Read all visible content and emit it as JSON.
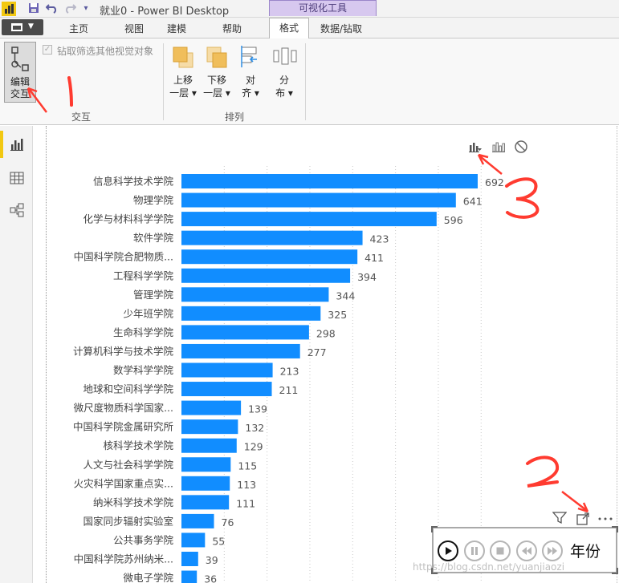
{
  "window": {
    "title": "就业0 - Power BI Desktop",
    "context_tab": "可视化工具"
  },
  "tabs": [
    {
      "label": "主页"
    },
    {
      "label": "视图"
    },
    {
      "label": "建模"
    },
    {
      "label": "帮助"
    },
    {
      "label": "格式",
      "active": true
    },
    {
      "label": "数据/钻取"
    }
  ],
  "ribbon": {
    "interaction_group": {
      "edit_interactions_label": "编辑\n交互",
      "drill_checkbox_label": "钻取筛选其他视觉对象",
      "group_label": "交互"
    },
    "arrange_group": {
      "bring_forward_label": "上移\n一层 ▾",
      "send_backward_label": "下移\n一层 ▾",
      "align_label": "对\n齐 ▾",
      "distribute_label": "分\n布 ▾",
      "group_label": "排列"
    }
  },
  "left_nav": {
    "items": [
      {
        "icon": "report-view-icon",
        "active": true
      },
      {
        "icon": "data-view-icon"
      },
      {
        "icon": "model-view-icon"
      }
    ]
  },
  "visual_header_icons": [
    "filter-icon",
    "focus-mode-icon",
    "more-options-icon"
  ],
  "interaction_icons": [
    "filter-interaction-icon",
    "highlight-interaction-icon",
    "none-interaction-icon"
  ],
  "chart_data": {
    "type": "bar",
    "orientation": "horizontal",
    "color": "#118dff",
    "categories": [
      "信息科学技术学院",
      "物理学院",
      "化学与材料科学学院",
      "软件学院",
      "中国科学院合肥物质...",
      "工程科学学院",
      "管理学院",
      "少年班学院",
      "生命科学学院",
      "计算机科学与技术学院",
      "数学科学学院",
      "地球和空间科学学院",
      "微尺度物质科学国家...",
      "中国科学院金属研究所",
      "核科学技术学院",
      "人文与社会科学学院",
      "火灾科学国家重点实...",
      "纳米科学技术学院",
      "国家同步辐射实验室",
      "公共事务学院",
      "中国科学院苏州纳米...",
      "微电子学院"
    ],
    "values": [
      692,
      641,
      596,
      423,
      411,
      394,
      344,
      325,
      298,
      277,
      213,
      211,
      139,
      132,
      129,
      115,
      113,
      111,
      76,
      55,
      39,
      36
    ],
    "data_labels": true,
    "grid": true
  },
  "play_axis": {
    "label": "年份",
    "buttons": [
      "play-icon",
      "pause-icon",
      "stop-icon",
      "previous-icon",
      "next-icon"
    ]
  },
  "annotations": [
    "1",
    "2",
    "3"
  ],
  "watermark": "https://blog.csdn.net/yuanjiaozi"
}
